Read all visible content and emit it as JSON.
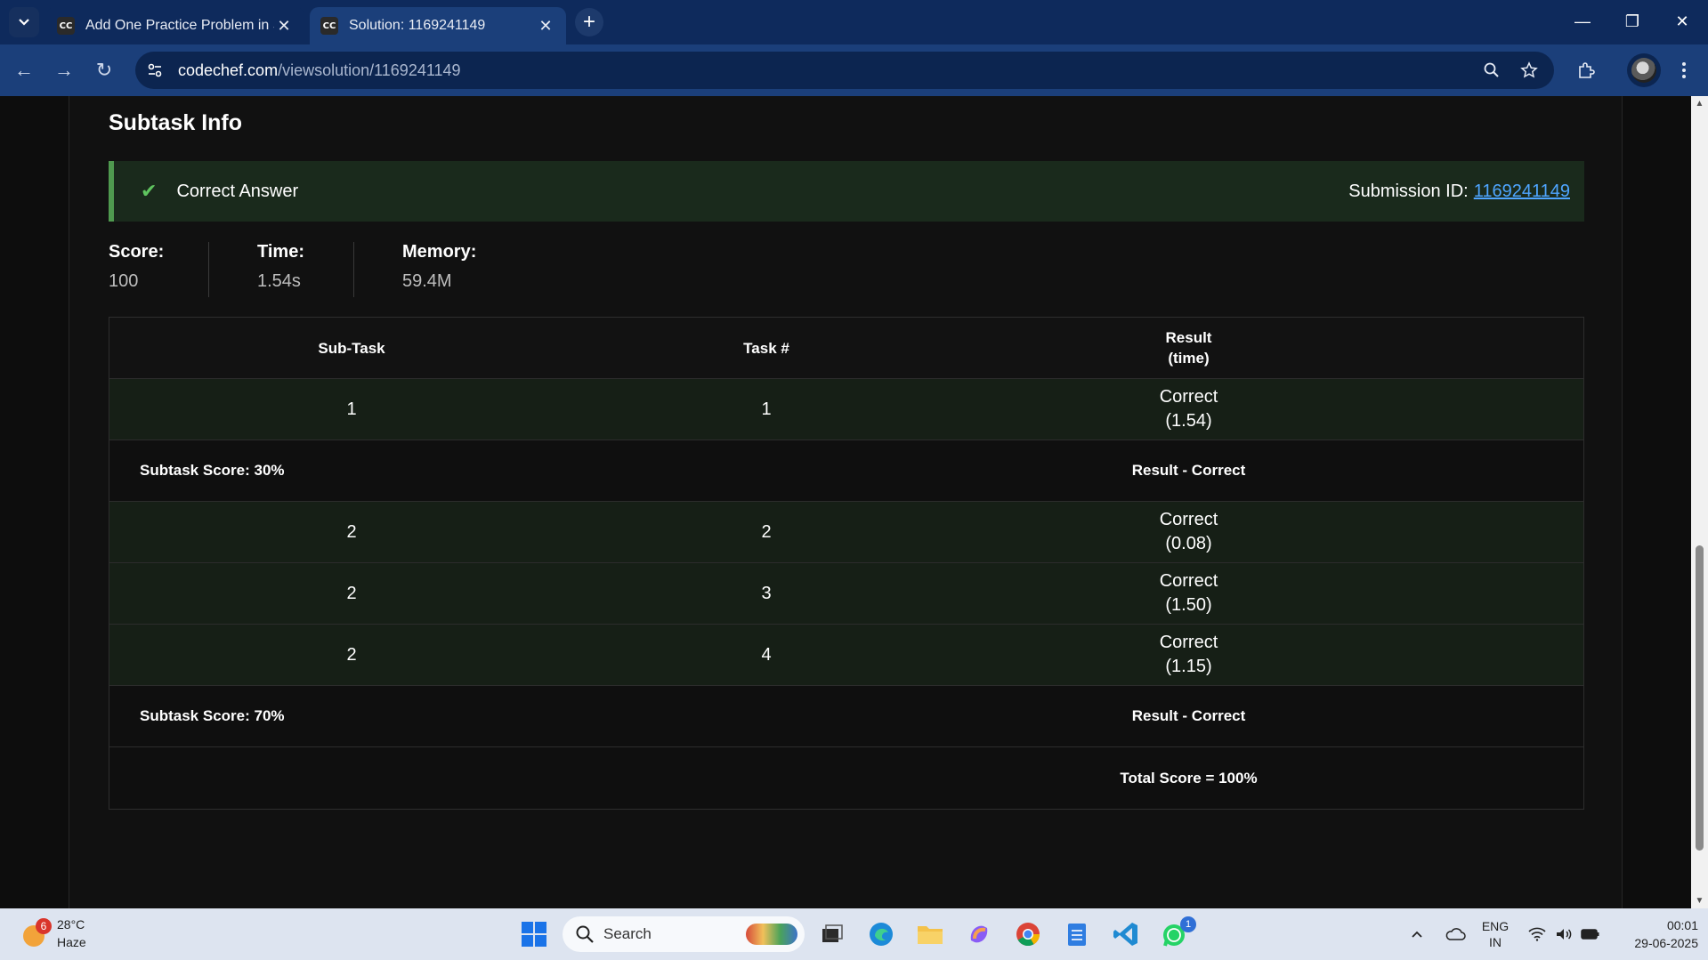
{
  "browser": {
    "tabs": [
      {
        "favicon": "CC",
        "title": "Add One Practice Problem in St",
        "active": false
      },
      {
        "favicon": "CC",
        "title": "Solution: 1169241149",
        "active": true
      }
    ],
    "url_domain": "codechef.com",
    "url_path": "/viewsolution/1169241149"
  },
  "page": {
    "section_title": "Subtask Info",
    "banner": {
      "status": "Correct Answer",
      "submission_label": "Submission ID:",
      "submission_id": "1169241149"
    },
    "stats": [
      {
        "label": "Score:",
        "value": "100"
      },
      {
        "label": "Time:",
        "value": "1.54s"
      },
      {
        "label": "Memory:",
        "value": "59.4M"
      }
    ],
    "table": {
      "headers": [
        "Sub-Task",
        "Task #",
        "Result",
        "(time)"
      ],
      "rows": [
        {
          "type": "data",
          "subtask": "1",
          "task": "1",
          "result": "Correct",
          "time": "(1.54)"
        },
        {
          "type": "summary",
          "score": "Subtask Score: 30%",
          "result": "Result - Correct"
        },
        {
          "type": "data",
          "subtask": "2",
          "task": "2",
          "result": "Correct",
          "time": "(0.08)"
        },
        {
          "type": "data",
          "subtask": "2",
          "task": "3",
          "result": "Correct",
          "time": "(1.50)"
        },
        {
          "type": "data",
          "subtask": "2",
          "task": "4",
          "result": "Correct",
          "time": "(1.15)"
        },
        {
          "type": "summary",
          "score": "Subtask Score: 70%",
          "result": "Result - Correct"
        },
        {
          "type": "total",
          "result": "Total Score = 100%"
        }
      ]
    }
  },
  "taskbar": {
    "weather": {
      "badge": "6",
      "temp": "28°C",
      "condition": "Haze"
    },
    "search_label": "Search",
    "whatsapp_badge": "1",
    "lang": [
      "ENG",
      "IN"
    ],
    "time": "00:01",
    "date": "29-06-2025"
  },
  "colors": {
    "accent_green": "#4f9a4f",
    "link_blue": "#4ea5ff",
    "chrome_blue": "#1b3f7a"
  }
}
